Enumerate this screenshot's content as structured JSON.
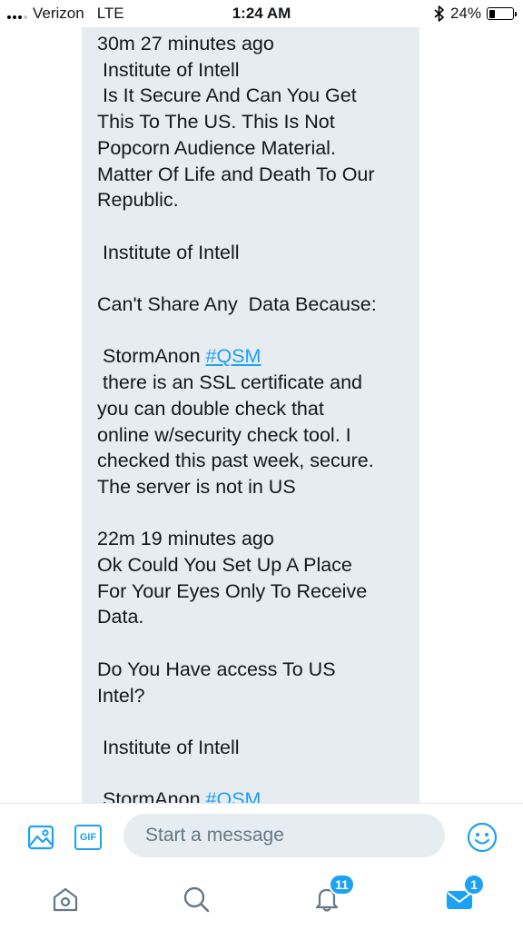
{
  "status_bar": {
    "carrier": "Verizon",
    "network": "LTE",
    "time": "1:24 AM",
    "battery": "24%",
    "battery_level": 0.24
  },
  "message": {
    "paragraphs": [
      {
        "lines": [
          "30m 27 minutes ago",
          " Institute of Intell",
          " Is It Secure And Can You Get",
          "This To The US. This Is Not",
          "Popcorn Audience Material.",
          "Matter Of Life and Death To Our",
          "Republic."
        ]
      },
      {
        "lines": [
          " Institute of Intell"
        ]
      },
      {
        "lines": [
          "Can't Share Any  Data Because:"
        ]
      },
      {
        "lines_pre": " StormAnon ",
        "hashtag": "#QSM",
        "lines": [
          " there is an SSL certificate and",
          "you can double check that",
          "online w/security check tool. I",
          "checked this past week, secure.",
          "The server is not in US"
        ]
      },
      {
        "lines": [
          "22m 19 minutes ago",
          "Ok Could You Set Up A Place",
          "For Your Eyes Only To Receive",
          "Data."
        ]
      },
      {
        "lines": [
          "Do You Have access To US",
          "Intel?"
        ]
      },
      {
        "lines": [
          " Institute of Intell"
        ]
      },
      {
        "lines_pre": " StormAnon ",
        "hashtag": "#QSM",
        "lines": []
      }
    ]
  },
  "composer": {
    "placeholder": "Start a message",
    "gif_label": "GIF"
  },
  "tabbar": {
    "notifications_count": "11",
    "messages_count": "1"
  },
  "colors": {
    "accent": "#1da1f2",
    "bubble": "#e6ecf0",
    "placeholder": "#657786"
  }
}
